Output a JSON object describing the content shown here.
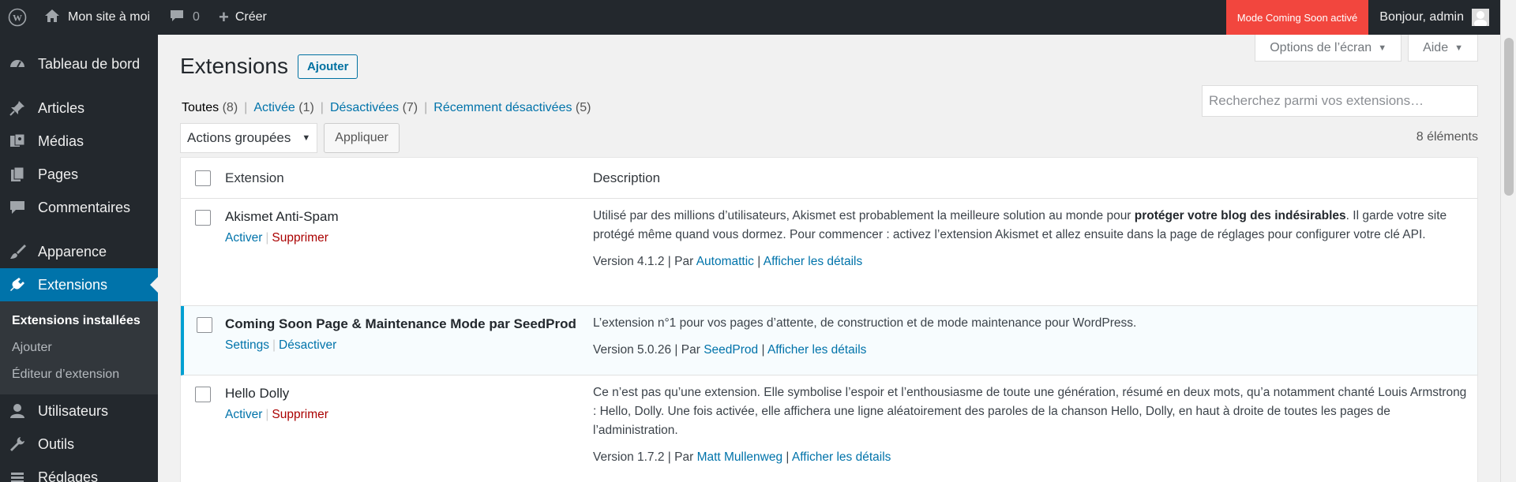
{
  "adminbar": {
    "site_name": "Mon site à moi",
    "comments_count": "0",
    "new_label": "Créer",
    "coming_soon": "Mode Coming Soon activé",
    "greeting": "Bonjour, admin"
  },
  "sidebar": {
    "items": [
      {
        "label": "Tableau de bord",
        "icon": "dashboard-icon"
      },
      {
        "label": "Articles",
        "icon": "pin-icon"
      },
      {
        "label": "Médias",
        "icon": "media-icon"
      },
      {
        "label": "Pages",
        "icon": "pages-icon"
      },
      {
        "label": "Commentaires",
        "icon": "comment-icon"
      },
      {
        "label": "Apparence",
        "icon": "brush-icon"
      },
      {
        "label": "Extensions",
        "icon": "plugin-icon"
      },
      {
        "label": "Utilisateurs",
        "icon": "user-icon"
      },
      {
        "label": "Outils",
        "icon": "wrench-icon"
      },
      {
        "label": "Réglages",
        "icon": "settings-icon"
      }
    ],
    "submenu": [
      "Extensions installées",
      "Ajouter",
      "Éditeur d’extension"
    ]
  },
  "screen_meta": {
    "options": "Options de l’écran",
    "help": "Aide"
  },
  "page": {
    "title": "Extensions",
    "add_button": "Ajouter"
  },
  "filters": {
    "all": "Toutes",
    "all_count": "(8)",
    "active": "Activée",
    "active_count": "(1)",
    "inactive": "Désactivées",
    "inactive_count": "(7)",
    "recent": "Récemment désactivées",
    "recent_count": "(5)"
  },
  "search": {
    "placeholder": "Recherchez parmi vos extensions…"
  },
  "bulk": {
    "select": "Actions groupées",
    "apply": "Appliquer",
    "items": "8 éléments"
  },
  "table": {
    "col_extension": "Extension",
    "col_description": "Description",
    "plugins": [
      {
        "name": "Akismet Anti-Spam",
        "action1": "Activer",
        "action2": "Supprimer",
        "desc_before": "Utilisé par des millions d’utilisateurs, Akismet est probablement la meilleure solution au monde pour ",
        "desc_strong": "protéger votre blog des indésirables",
        "desc_after": ". Il garde votre site protégé même quand vous dormez. Pour commencer : activez l’extension Akismet et allez ensuite dans la page de réglages pour configurer votre clé API.",
        "version": "Version 4.1.2",
        "by": "Par",
        "author": "Automattic",
        "details": "Afficher les détails"
      },
      {
        "name": "Coming Soon Page & Maintenance Mode par SeedProd",
        "action1": "Settings",
        "action2": "Désactiver",
        "desc": "L’extension n°1 pour vos pages d’attente, de construction et de mode maintenance pour WordPress.",
        "version": "Version 5.0.26",
        "by": "Par",
        "author": "SeedProd",
        "details": "Afficher les détails"
      },
      {
        "name": "Hello Dolly",
        "action1": "Activer",
        "action2": "Supprimer",
        "desc": "Ce n’est pas qu’une extension. Elle symbolise l’espoir et l’enthousiasme de toute une génération, résumé en deux mots, qu’a notamment chanté Louis Armstrong : Hello, Dolly. Une fois activée, elle affichera une ligne aléatoirement des paroles de la chanson Hello, Dolly, en haut à droite de toutes les pages de l’administration.",
        "version": "Version 1.7.2",
        "by": "Par",
        "author": "Matt Mullenweg",
        "details": "Afficher les détails"
      }
    ]
  }
}
